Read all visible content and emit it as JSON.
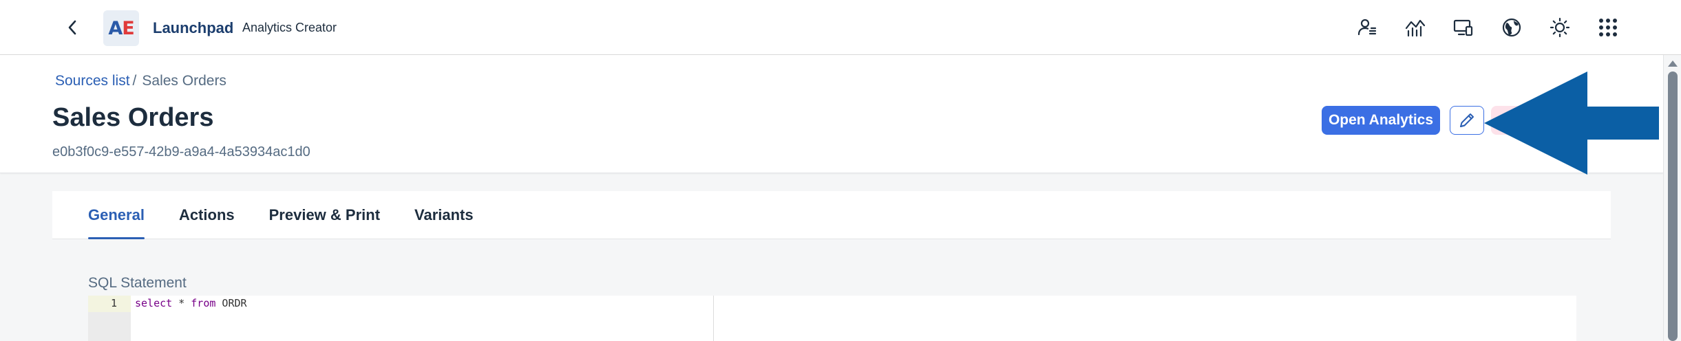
{
  "shell": {
    "back_icon": "chevron-left-icon",
    "logo": {
      "left": "A",
      "right": "E"
    },
    "title": "Launchpad",
    "subtitle": "Analytics Creator",
    "icons": [
      "user-list-icon",
      "analytics-chart-icon",
      "devices-icon",
      "globe-icon",
      "sun-icon",
      "app-grid-icon"
    ]
  },
  "breadcrumb": {
    "link": "Sources list",
    "separator": "/",
    "current": "Sales Orders"
  },
  "object": {
    "title": "Sales Orders",
    "id": "e0b3f0c9-e557-42b9-a9a4-4a53934ac1d0"
  },
  "actions": {
    "open_label": "Open Analytics",
    "edit_icon": "pencil-icon",
    "delete_color": "#fde2ea"
  },
  "annotation": {
    "type": "arrow",
    "color": "#0b5fa5",
    "points_to": "edit-button"
  },
  "tabs": [
    {
      "label": "General",
      "active": true
    },
    {
      "label": "Actions",
      "active": false
    },
    {
      "label": "Preview & Print",
      "active": false
    },
    {
      "label": "Variants",
      "active": false
    }
  ],
  "sql": {
    "label": "SQL Statement",
    "lines": [
      {
        "number": "1",
        "tokens": [
          {
            "text": "select",
            "kind": "keyword"
          },
          {
            "text": " * ",
            "kind": "plain"
          },
          {
            "text": "from",
            "kind": "keyword"
          },
          {
            "text": " ORDR",
            "kind": "plain"
          }
        ]
      }
    ]
  },
  "colors": {
    "accent": "#3b6fe4",
    "link": "#2b5fb4",
    "brand_blue": "#2a5aa8",
    "brand_red": "#e03a3a",
    "sql_keyword": "#770088"
  }
}
